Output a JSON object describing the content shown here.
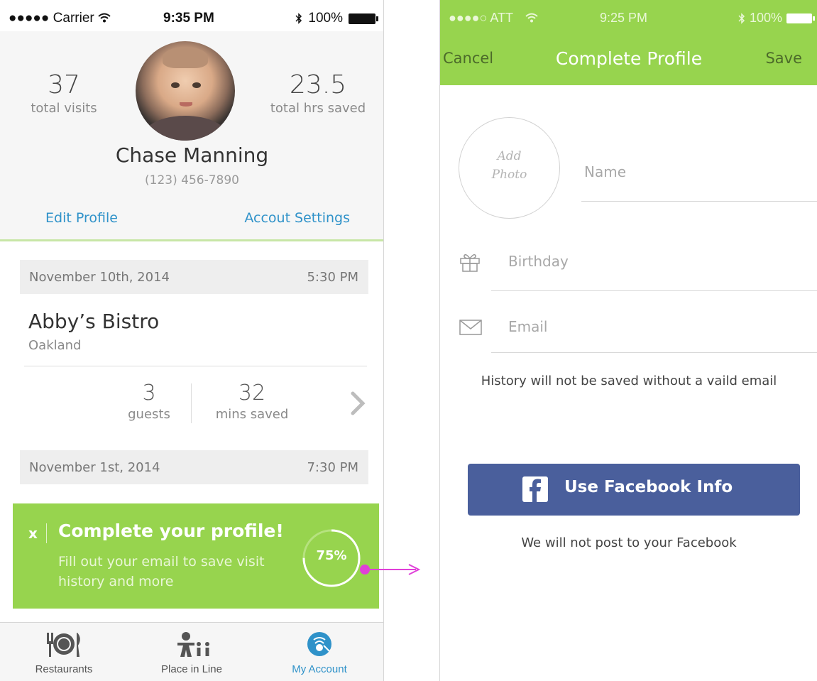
{
  "left_screen": {
    "statusbar": {
      "carrier": "●●●●● Carrier",
      "time": "9:35 PM",
      "battery": "100%"
    },
    "profile": {
      "visits_value": "37",
      "visits_label": "total visits",
      "hours_value": "23.5",
      "hours_label": "total hrs saved",
      "name": "Chase Manning",
      "phone": "(123) 456-7890",
      "edit_link": "Edit Profile",
      "settings_link": "Accout Settings"
    },
    "visits": [
      {
        "date": "November 10th, 2014",
        "time": "5:30 PM",
        "restaurant": "Abby’s Bistro",
        "city": "Oakland",
        "guests_value": "3",
        "guests_label": "guests",
        "mins_value": "32",
        "mins_label": "mins saved"
      },
      {
        "date": "November 1st, 2014",
        "time": "7:30 PM"
      }
    ],
    "promo": {
      "close": "x",
      "title": "Complete your profile!",
      "body": "Fill out your email to save visit history and more",
      "progress_label": "75%",
      "progress": 0.75
    },
    "tabs": [
      {
        "label": "Restaurants",
        "icon": "restaurants-icon"
      },
      {
        "label": "Place in Line",
        "icon": "place-in-line-icon"
      },
      {
        "label": "My Account",
        "icon": "my-account-icon",
        "active": true
      }
    ]
  },
  "right_screen": {
    "statusbar": {
      "carrier": "●●●●○ ATT",
      "time": "9:25 PM",
      "battery": "100%"
    },
    "nav": {
      "cancel": "Cancel",
      "title": "Complete Profile",
      "save": "Save"
    },
    "form": {
      "add_photo_line1": "Add",
      "add_photo_line2": "Photo",
      "name_placeholder": "Name",
      "birthday_placeholder": "Birthday",
      "email_placeholder": "Email",
      "email_hint": "History will not be saved without a vaild email"
    },
    "facebook": {
      "button_label": "Use Facebook Info",
      "note": "We will not post to your Facebook"
    }
  },
  "colors": {
    "green": "#97d44e",
    "link_blue": "#2f92c9",
    "facebook_blue": "#4a5f9c",
    "arrow_magenta": "#e040d8"
  }
}
